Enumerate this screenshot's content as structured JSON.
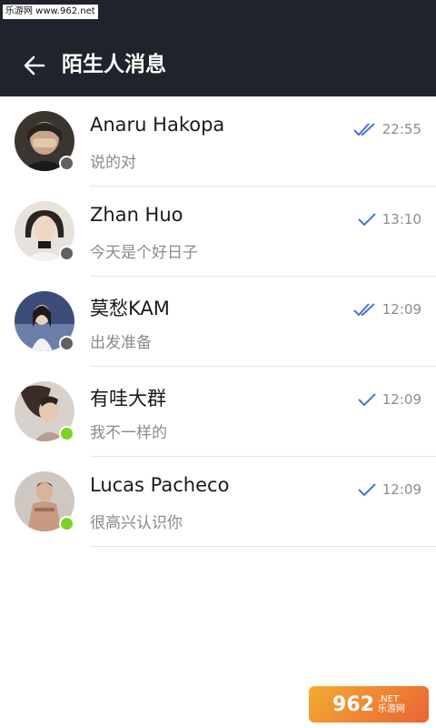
{
  "watermark": {
    "top_text": "乐游网 www.962.net",
    "badge_num": "962",
    "badge_net": ".NET",
    "badge_site": "乐游网"
  },
  "header": {
    "title": "陌生人消息"
  },
  "colors": {
    "header_bg": "#1f232b",
    "check": "#4a73d4",
    "online": "#7dd321",
    "offline": "#616161"
  },
  "conversations": [
    {
      "name": "Anaru Hakopa",
      "preview": "说的对",
      "time": "22:55",
      "status": "read",
      "presence": "offline"
    },
    {
      "name": "Zhan Huo",
      "preview": "今天是个好日子",
      "time": "13:10",
      "status": "delivered",
      "presence": "offline"
    },
    {
      "name": "莫愁KAM",
      "preview": "出发准备",
      "time": "12:09",
      "status": "read",
      "presence": "offline"
    },
    {
      "name": "有哇大群",
      "preview": "我不一样的",
      "time": "12:09",
      "status": "delivered",
      "presence": "online"
    },
    {
      "name": "Lucas Pacheco",
      "preview": "很高兴认识你",
      "time": "12:09",
      "status": "delivered",
      "presence": "online"
    }
  ]
}
